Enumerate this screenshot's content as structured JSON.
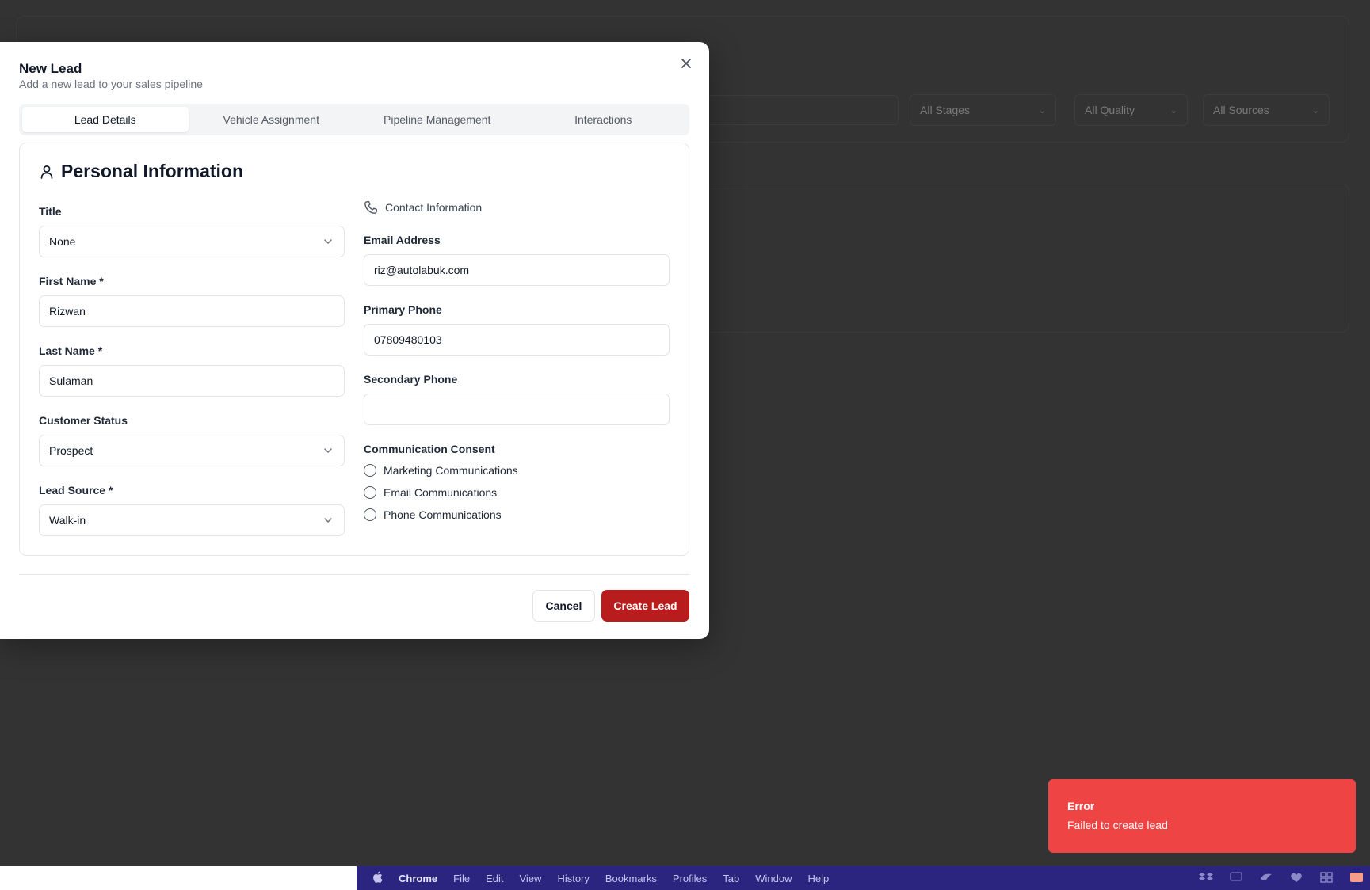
{
  "background": {
    "filters": [
      {
        "label": "All Stages"
      },
      {
        "label": "All Quality"
      },
      {
        "label": "All Sources"
      }
    ]
  },
  "modal": {
    "title": "New Lead",
    "subtitle": "Add a new lead to your sales pipeline",
    "tabs": [
      {
        "label": "Lead Details",
        "active": true
      },
      {
        "label": "Vehicle Assignment",
        "active": false
      },
      {
        "label": "Pipeline Management",
        "active": false
      },
      {
        "label": "Interactions",
        "active": false
      }
    ],
    "section_title": "Personal Information",
    "left": {
      "title_label": "Title",
      "title_value": "None",
      "first_name_label": "First Name *",
      "first_name_value": "Rizwan",
      "last_name_label": "Last Name *",
      "last_name_value": "Sulaman",
      "status_label": "Customer Status",
      "status_value": "Prospect",
      "source_label": "Lead Source *",
      "source_value": "Walk-in"
    },
    "right": {
      "contact_heading": "Contact Information",
      "email_label": "Email Address",
      "email_value": "riz@autolabuk.com",
      "primary_phone_label": "Primary Phone",
      "primary_phone_value": "07809480103",
      "secondary_phone_label": "Secondary Phone",
      "secondary_phone_value": "",
      "consent_label": "Communication Consent",
      "consents": [
        {
          "label": "Marketing Communications",
          "checked": false
        },
        {
          "label": "Email Communications",
          "checked": false
        },
        {
          "label": "Phone Communications",
          "checked": false
        }
      ]
    },
    "buttons": {
      "cancel": "Cancel",
      "create": "Create Lead"
    }
  },
  "toast": {
    "title": "Error",
    "message": "Failed to create lead",
    "color": "#ef4444"
  },
  "menubar": {
    "app": "Chrome",
    "items": [
      "File",
      "Edit",
      "View",
      "History",
      "Bookmarks",
      "Profiles",
      "Tab",
      "Window",
      "Help"
    ]
  },
  "colors": {
    "accent": "#b91c1c",
    "overlay": "#333333",
    "menubar": "#2b2580"
  }
}
